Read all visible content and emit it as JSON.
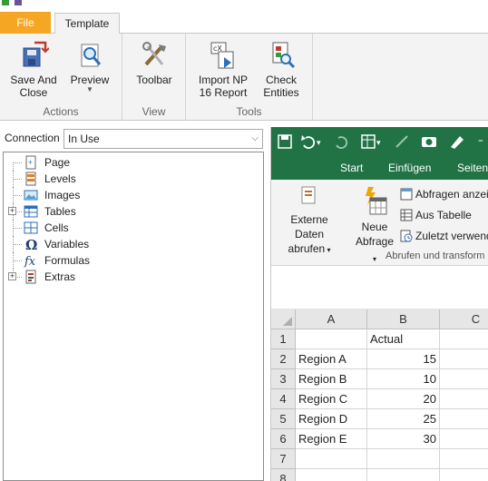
{
  "tabs": {
    "file": "File",
    "template": "Template"
  },
  "ribbon": {
    "groups": [
      {
        "label": "Actions",
        "buttons": [
          {
            "label": "Save And\nClose",
            "icon": "save-and-close-icon"
          },
          {
            "label": "Preview",
            "icon": "preview-magnifier-icon",
            "has_dropdown": true
          }
        ]
      },
      {
        "label": "View",
        "buttons": [
          {
            "label": "Toolbar",
            "icon": "toolbar-tools-icon"
          }
        ]
      },
      {
        "label": "Tools",
        "buttons": [
          {
            "label": "Import NP\n16 Report",
            "icon": "import-report-icon"
          },
          {
            "label": "Check\nEntities",
            "icon": "check-entities-icon"
          }
        ]
      }
    ]
  },
  "connection": {
    "label": "Connection",
    "value": "In Use"
  },
  "tree": {
    "items": [
      {
        "label": "Page",
        "icon": "page-icon",
        "expandable": false
      },
      {
        "label": "Levels",
        "icon": "levels-icon",
        "expandable": false
      },
      {
        "label": "Images",
        "icon": "images-icon",
        "expandable": false
      },
      {
        "label": "Tables",
        "icon": "tables-icon",
        "expandable": true
      },
      {
        "label": "Cells",
        "icon": "cells-icon",
        "expandable": false
      },
      {
        "label": "Variables",
        "icon": "omega-variables-icon",
        "expandable": false
      },
      {
        "label": "Formulas",
        "icon": "fx-formulas-icon",
        "expandable": false
      },
      {
        "label": "Extras",
        "icon": "extras-icon",
        "expandable": true
      }
    ]
  },
  "excel": {
    "tabs": [
      "Start",
      "Einfügen",
      "Seitenl"
    ],
    "ribbon": {
      "external_data": "Externe Daten\nabrufen",
      "new_query": "Neue\nAbfrage",
      "show_queries": "Abfragen anzei",
      "from_table": "Aus Tabelle",
      "recent_sources": "Zuletzt verwend",
      "group_label": "Abrufen und transform"
    },
    "colors": {
      "accent": "#217346"
    },
    "grid": {
      "columns": [
        "A",
        "B",
        "C"
      ],
      "rows": [
        {
          "n": "1",
          "a": "",
          "b": "Actual"
        },
        {
          "n": "2",
          "a": "Region A",
          "b": "15"
        },
        {
          "n": "3",
          "a": "Region B",
          "b": "10"
        },
        {
          "n": "4",
          "a": "Region C",
          "b": "20"
        },
        {
          "n": "5",
          "a": "Region D",
          "b": "25"
        },
        {
          "n": "6",
          "a": "Region E",
          "b": "30"
        },
        {
          "n": "7",
          "a": "",
          "b": ""
        },
        {
          "n": "8",
          "a": "",
          "b": ""
        }
      ]
    }
  }
}
